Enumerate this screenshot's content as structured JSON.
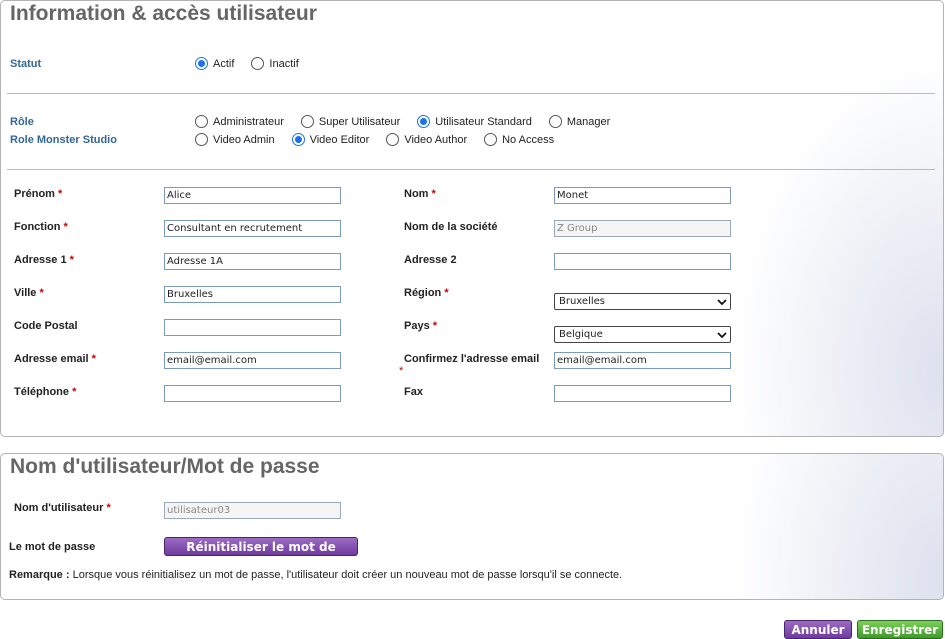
{
  "info_panel": {
    "title": "Information & accès utilisateur",
    "status": {
      "label": "Statut",
      "options": [
        {
          "label": "Actif",
          "checked": true
        },
        {
          "label": "Inactif",
          "checked": false
        }
      ]
    },
    "role": {
      "label": "Rôle",
      "options": [
        {
          "label": "Administrateur",
          "checked": false
        },
        {
          "label": "Super Utilisateur",
          "checked": false
        },
        {
          "label": "Utilisateur Standard",
          "checked": true
        },
        {
          "label": "Manager",
          "checked": false
        }
      ]
    },
    "role_monster": {
      "label": "Role Monster Studio",
      "options": [
        {
          "label": "Video Admin",
          "checked": false
        },
        {
          "label": "Video Editor",
          "checked": true
        },
        {
          "label": "Video Author",
          "checked": false
        },
        {
          "label": "No Access",
          "checked": false
        }
      ]
    },
    "required_mark": "*",
    "fields": {
      "prenom": {
        "label": "Prénom",
        "value": "Alice"
      },
      "nom": {
        "label": "Nom",
        "value": "Monet"
      },
      "fonction": {
        "label": "Fonction",
        "value": "Consultant en recrutement"
      },
      "societe": {
        "label": "Nom de la société",
        "value": "Z Group"
      },
      "adresse1": {
        "label": "Adresse 1",
        "value": "Adresse 1A"
      },
      "adresse2": {
        "label": "Adresse 2",
        "value": ""
      },
      "ville": {
        "label": "Ville",
        "value": "Bruxelles"
      },
      "region": {
        "label": "Région",
        "value": "Bruxelles"
      },
      "code_postal": {
        "label": "Code Postal",
        "value": ""
      },
      "pays": {
        "label": "Pays",
        "value": "Belgique"
      },
      "email": {
        "label": "Adresse email",
        "value": "email@email.com"
      },
      "email_confirm": {
        "label": "Confirmez l'adresse email",
        "value": "email@email.com"
      },
      "telephone": {
        "label": "Téléphone",
        "value": ""
      },
      "fax": {
        "label": "Fax",
        "value": ""
      }
    }
  },
  "login_panel": {
    "title": "Nom d'utilisateur/Mot de passe",
    "username": {
      "label": "Nom d'utilisateur",
      "value": "utilisateur03"
    },
    "password_label": "Le mot de passe",
    "reset_button": "Réinitialiser le mot de passe",
    "note_bold": "Remarque :",
    "note_text": " Lorsque vous réinitialisez un mot de passe, l'utilisateur doit créer un nouveau mot de passe lorsqu'il se connecte."
  },
  "actions": {
    "cancel": "Annuler",
    "save": "Enregistrer"
  },
  "colors": {
    "label_blue": "#336699",
    "radio_checked": "#1a73e8",
    "required": "#cc0000",
    "button_purple": "#6f3b9e",
    "button_green": "#3f9a2a"
  },
  "icons": {
    "select_arrow": "chevron-down-icon"
  }
}
